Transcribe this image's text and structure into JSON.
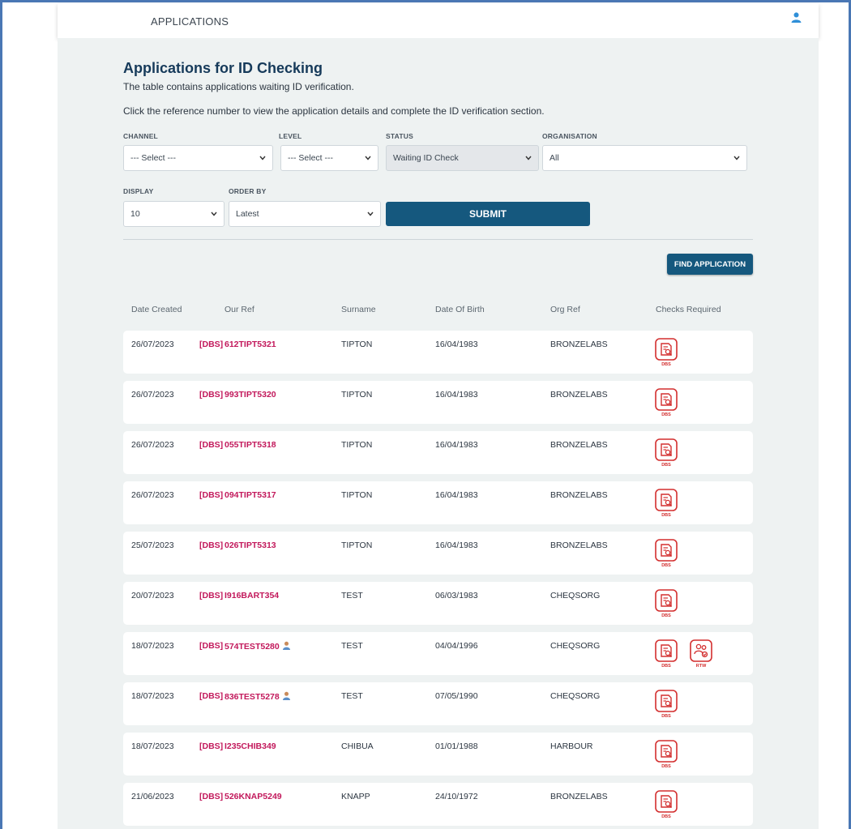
{
  "nav": {
    "tab": "APPLICATIONS"
  },
  "page": {
    "title": "Applications for ID Checking",
    "desc1": "The table contains applications waiting ID verification.",
    "desc2": "Click the reference number to view the application details and complete the ID verification section."
  },
  "filters": {
    "channel": {
      "label": "CHANNEL",
      "value": "--- Select ---"
    },
    "level": {
      "label": "LEVEL",
      "value": "--- Select ---"
    },
    "status": {
      "label": "STATUS",
      "value": "Waiting ID Check"
    },
    "organisation": {
      "label": "ORGANISATION",
      "value": "All"
    },
    "display": {
      "label": "DISPLAY",
      "value": "10"
    },
    "order_by": {
      "label": "ORDER BY",
      "value": "Latest"
    },
    "submit_label": "SUBMIT"
  },
  "find_label": "FIND APPLICATION",
  "columns": [
    "Date Created",
    "Our Ref",
    "Surname",
    "Date Of Birth",
    "Org Ref",
    "Checks Required"
  ],
  "rows": [
    {
      "date": "26/07/2023",
      "type": "[DBS]",
      "ref": "612TIPT5321",
      "surname": "TIPTON",
      "dob": "16/04/1983",
      "org": "BRONZELABS",
      "checks": [
        "DBS"
      ],
      "person": false
    },
    {
      "date": "26/07/2023",
      "type": "[DBS]",
      "ref": "993TIPT5320",
      "surname": "TIPTON",
      "dob": "16/04/1983",
      "org": "BRONZELABS",
      "checks": [
        "DBS"
      ],
      "person": false
    },
    {
      "date": "26/07/2023",
      "type": "[DBS]",
      "ref": "055TIPT5318",
      "surname": "TIPTON",
      "dob": "16/04/1983",
      "org": "BRONZELABS",
      "checks": [
        "DBS"
      ],
      "person": false
    },
    {
      "date": "26/07/2023",
      "type": "[DBS]",
      "ref": "094TIPT5317",
      "surname": "TIPTON",
      "dob": "16/04/1983",
      "org": "BRONZELABS",
      "checks": [
        "DBS"
      ],
      "person": false
    },
    {
      "date": "25/07/2023",
      "type": "[DBS]",
      "ref": "026TIPT5313",
      "surname": "TIPTON",
      "dob": "16/04/1983",
      "org": "BRONZELABS",
      "checks": [
        "DBS"
      ],
      "person": false
    },
    {
      "date": "20/07/2023",
      "type": "[DBS]",
      "ref": "I916BART354",
      "surname": "TEST",
      "dob": "06/03/1983",
      "org": "CHEQSORG",
      "checks": [
        "DBS"
      ],
      "person": false
    },
    {
      "date": "18/07/2023",
      "type": "[DBS]",
      "ref": "574TEST5280",
      "surname": "TEST",
      "dob": "04/04/1996",
      "org": "CHEQSORG",
      "checks": [
        "DBS",
        "RTW"
      ],
      "person": true
    },
    {
      "date": "18/07/2023",
      "type": "[DBS]",
      "ref": "836TEST5278",
      "surname": "TEST",
      "dob": "07/05/1990",
      "org": "CHEQSORG",
      "checks": [
        "DBS"
      ],
      "person": true
    },
    {
      "date": "18/07/2023",
      "type": "[DBS]",
      "ref": "I235CHIB349",
      "surname": "CHIBUA",
      "dob": "01/01/1988",
      "org": "HARBOUR",
      "checks": [
        "DBS"
      ],
      "person": false
    },
    {
      "date": "21/06/2023",
      "type": "[DBS]",
      "ref": "526KNAP5249",
      "surname": "KNAPP",
      "dob": "24/10/1972",
      "org": "BRONZELABS",
      "checks": [
        "DBS"
      ],
      "person": false
    }
  ],
  "colors": {
    "primary": "#15587e",
    "ref": "#c2185b",
    "check_icon": "#d32f2f",
    "background": "#eef2f2"
  },
  "icons": {
    "user": "user-icon",
    "person": "person-icon",
    "dbs_check": "document-search-icon",
    "rtw_check": "people-check-icon",
    "chevron": "chevron-down-icon"
  }
}
